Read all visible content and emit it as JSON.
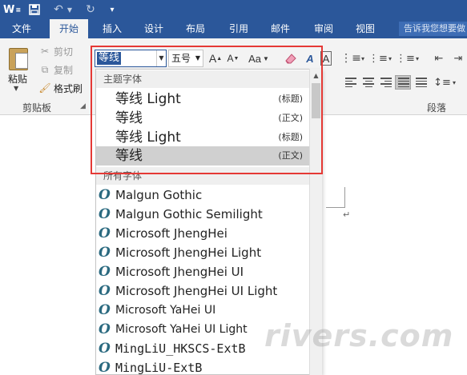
{
  "quick_access": {
    "logo": "W",
    "icons": [
      "word-logo-icon",
      "save-icon",
      "undo-icon",
      "redo-icon",
      "customize-qat-icon"
    ]
  },
  "tabs": [
    {
      "label": "文件",
      "active": false
    },
    {
      "label": "开始",
      "active": true
    },
    {
      "label": "插入",
      "active": false
    },
    {
      "label": "设计",
      "active": false
    },
    {
      "label": "布局",
      "active": false
    },
    {
      "label": "引用",
      "active": false
    },
    {
      "label": "邮件",
      "active": false
    },
    {
      "label": "审阅",
      "active": false
    },
    {
      "label": "视图",
      "active": false
    }
  ],
  "tell_me": {
    "placeholder": "告诉我您想要做"
  },
  "clipboard": {
    "paste_label": "粘贴",
    "cut_label": "剪切",
    "copy_label": "复制",
    "format_painter_label": "格式刷",
    "group_label": "剪贴板"
  },
  "font": {
    "name_value": "等线",
    "size_value": "五号",
    "change_case_label": "Aa"
  },
  "paragraph": {
    "group_label": "段落"
  },
  "font_dropdown": {
    "theme_header": "主题字体",
    "theme_fonts": [
      {
        "name": "等线 Light",
        "tag": "(标题)",
        "highlight": false
      },
      {
        "name": "等线",
        "tag": "(正文)",
        "highlight": false
      },
      {
        "name": "等线 Light",
        "tag": "(标题)",
        "highlight": false
      },
      {
        "name": "等线",
        "tag": "(正文)",
        "highlight": true
      }
    ],
    "all_header": "所有字体",
    "all_fonts": [
      "Malgun Gothic",
      "Malgun Gothic Semilight",
      "Microsoft JhengHei",
      "Microsoft JhengHei Light",
      "Microsoft JhengHei UI",
      "Microsoft JhengHei UI Light",
      "Microsoft YaHei UI",
      "Microsoft YaHei UI Light",
      "MingLiU_HKSCS-ExtB",
      "MingLiU-ExtB"
    ]
  },
  "document": {
    "paragraph_mark": "↵"
  },
  "watermark": "rivers.com",
  "colors": {
    "ribbon_blue": "#2b579a",
    "highlight_frame": "#e53935"
  }
}
